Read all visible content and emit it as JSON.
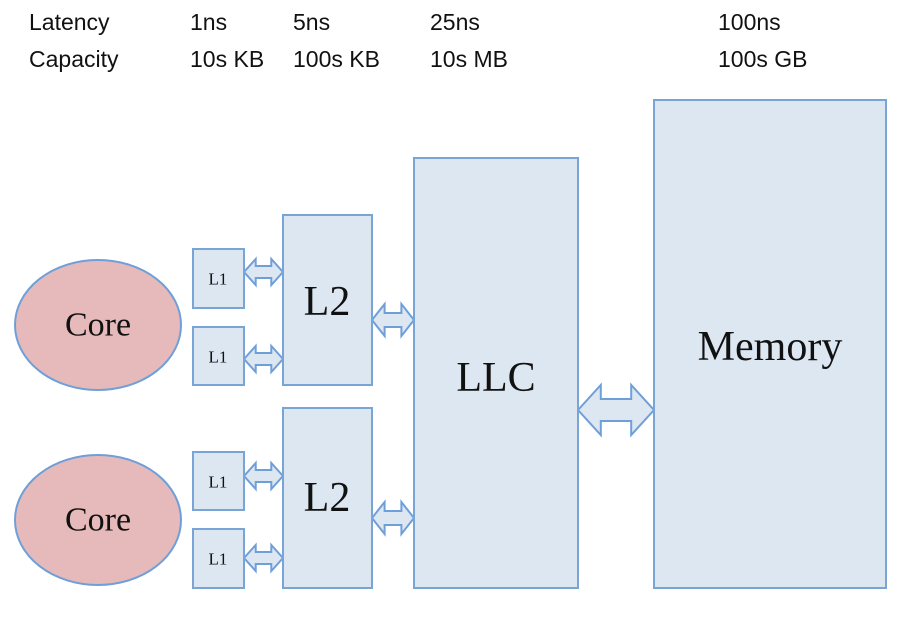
{
  "header": {
    "row_labels": [
      "Latency",
      "Capacity"
    ],
    "columns": [
      {
        "latency": "1ns",
        "capacity": "10s KB"
      },
      {
        "latency": "5ns",
        "capacity": "100s KB"
      },
      {
        "latency": "25ns",
        "capacity": "10s MB"
      },
      {
        "latency": "100ns",
        "capacity": "100s GB"
      }
    ]
  },
  "nodes": {
    "core": "Core",
    "l1": "L1",
    "l2": "L2",
    "llc": "LLC",
    "memory": "Memory"
  },
  "colors": {
    "box_fill": "#dde7f2",
    "box_stroke": "#79a4d6",
    "core_fill": "#e6baba"
  }
}
